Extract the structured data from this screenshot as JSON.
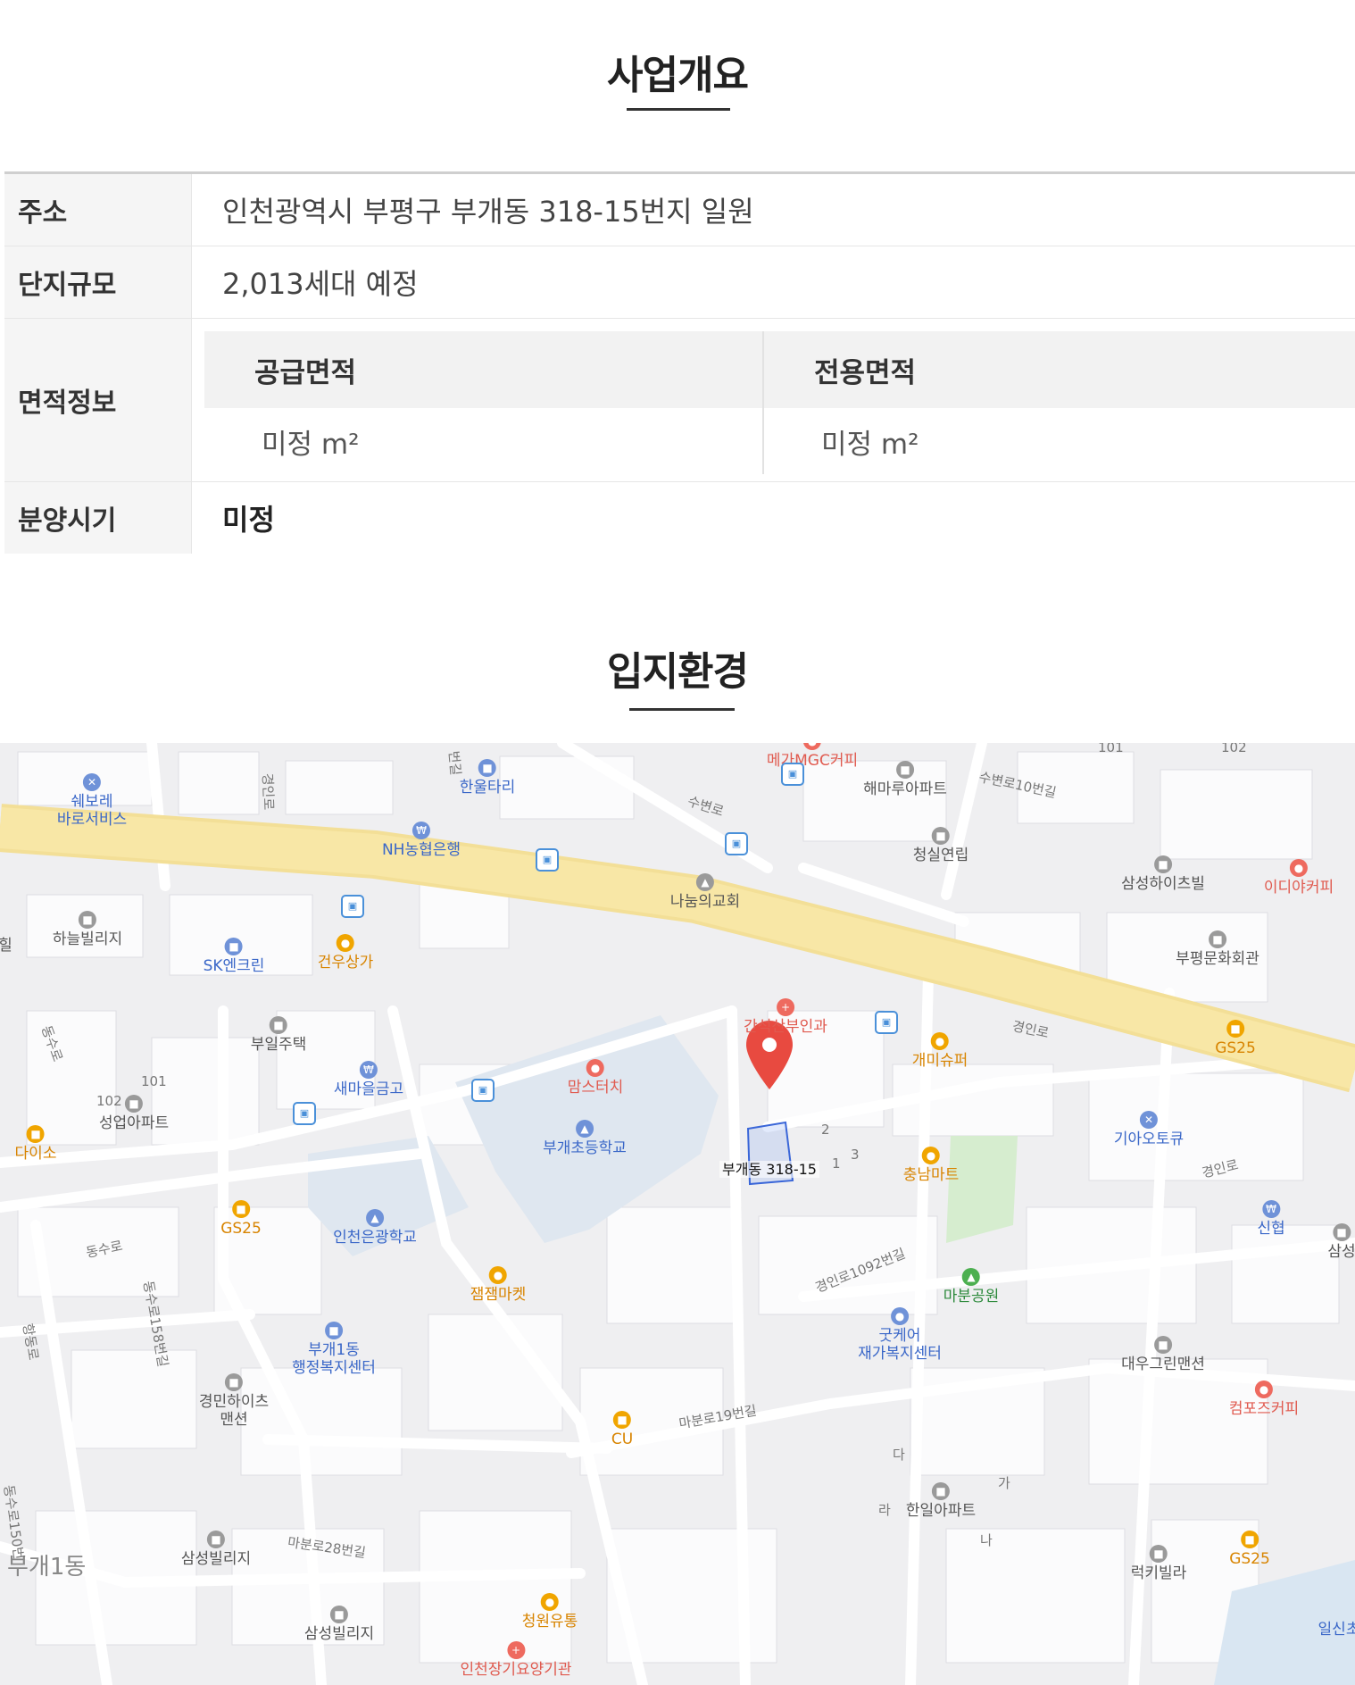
{
  "overview": {
    "title": "사업개요",
    "rows": [
      {
        "label": "주소",
        "value": "인천광역시 부평구 부개동 318-15번지 일원"
      },
      {
        "label": "단지규모",
        "value": "2,013세대 예정"
      },
      {
        "label": "면적정보"
      },
      {
        "label": "분양시기",
        "value": "미정"
      }
    ],
    "area": {
      "supply_label": "공급면적",
      "supply_value": "미정 m²",
      "exclusive_label": "전용면적",
      "exclusive_value": "미정 m²"
    }
  },
  "location": {
    "title": "입지환경",
    "marker_label": "부개동 318-15",
    "pois": {
      "mega": "메가MGC커피",
      "haemaru": "해마루아파트",
      "hanul": "한울타리",
      "shoebore1": "쉐보레",
      "shoebore2": "바로서비스",
      "nh": "NH농협은행",
      "cheongsil": "청실연립",
      "samsung_heights": "삼성하이츠빌",
      "ediya": "이디야커피",
      "nanum": "나눔의교회",
      "haneul": "하늘빌리지",
      "sk": "SK엔크린",
      "gunwoo": "건우상가",
      "bupyeong_culture": "부평문화회관",
      "ganseok": "간석산부인과",
      "gs25_a": "GS25",
      "gaemi": "개미슈퍼",
      "buil": "부일주택",
      "saemaeul": "새마을금고",
      "mamstouch": "맘스터치",
      "seongeop": "성업아파트",
      "daiso": "다이소",
      "bugae_elem": "부개초등학교",
      "kia": "기아오토큐",
      "chungnam": "충남마트",
      "gs25_b": "GS25",
      "incheon_eungwang": "인천은광학교",
      "shinhyeop": "신협",
      "samseong_edge": "삼성",
      "jamjam": "잼잼마켓",
      "mabun_park": "마분공원",
      "goodcare1": "굿케어",
      "goodcare2": "재가복지센터",
      "bugae1_1": "부개1동",
      "bugae1_2": "행정복지센터",
      "daewoo": "대우그린맨션",
      "compose": "컴포즈커피",
      "gyeongmin1": "경민하이츠",
      "gyeongmin2": "맨션",
      "cu": "CU",
      "hanil": "한일아파트",
      "samseong_villa1": "삼성빌리지",
      "gs25_c": "GS25",
      "lucky": "럭키빌라",
      "cheongwon": "청원유통",
      "samseong_villa2": "삼성빌리지",
      "incheon_care": "인천장기요양기관",
      "ilsin": "일신초",
      "district": "부개1동",
      "hil": "힐"
    },
    "roads": {
      "gyeongin": "경인로",
      "gyeongin2": "경인로",
      "dongsu": "동수로",
      "dongsu2": "동수로",
      "dongsu158": "동수로158번길",
      "dongsu150": "동수로150번",
      "hangdong": "항동로",
      "mabun19": "마분로19번길",
      "mabun28": "마분로28번길",
      "gyeongin1092": "경인로1092번길",
      "subyeon10": "수변로10번길",
      "gyeongin_v": "경인로",
      "subyeon": "수변로",
      "beongil": "번길"
    },
    "lot_numbers": {
      "n2": "2",
      "n3": "3",
      "n1": "1",
      "n101a": "101",
      "n102a": "102",
      "n101b": "101",
      "n102b": "102",
      "da": "다",
      "ga": "가",
      "ra": "라",
      "na": "나"
    }
  }
}
